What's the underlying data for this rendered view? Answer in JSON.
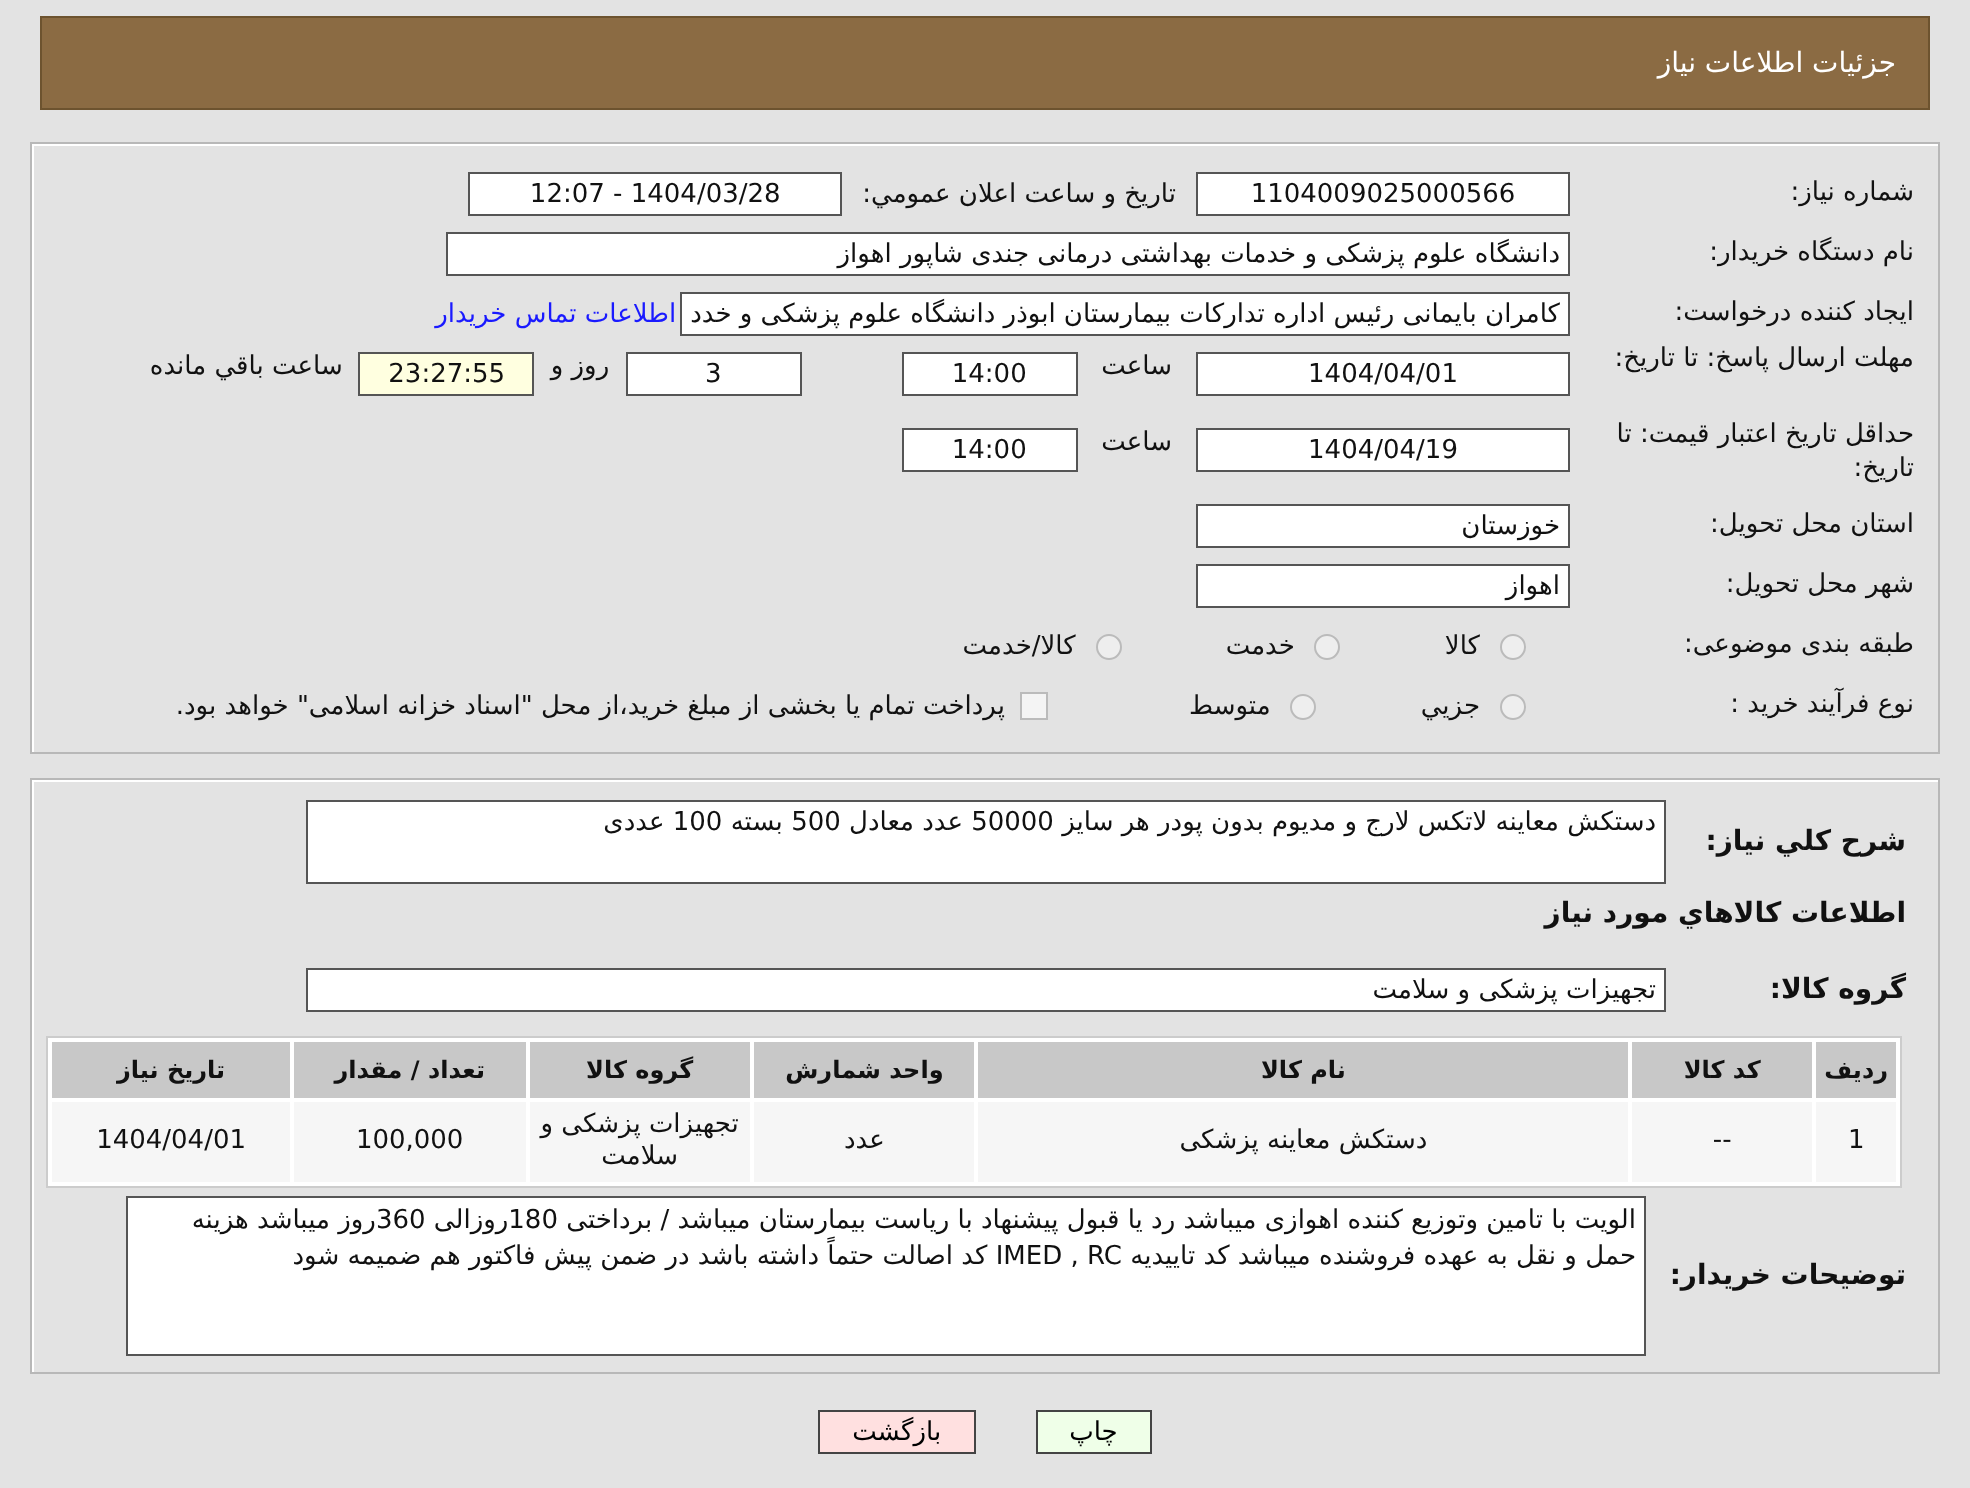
{
  "header": {
    "title": "جزئیات اطلاعات نیاز"
  },
  "details": {
    "need_number": {
      "label": "شماره نیاز:",
      "value": "1104009025000566"
    },
    "announce": {
      "label": "تاریخ و ساعت اعلان عمومي:",
      "value": "1404/03/28 - 12:07"
    },
    "buyer": {
      "label": "نام دستگاه خریدار:",
      "value": "دانشگاه علوم پزشکی و خدمات بهداشتی درمانی جندی شاپور اهواز"
    },
    "creator": {
      "label": "ایجاد کننده درخواست:",
      "value": "کامران بایمانی رئیس اداره تدارکات بیمارستان ابوذر  دانشگاه علوم پزشکی و خدد",
      "link": "اطلاعات تماس خریدار"
    },
    "deadline": {
      "label": "مهلت ارسال پاسخ: تا تاریخ:",
      "date": "1404/04/01",
      "time_label": "ساعت",
      "time": "14:00",
      "days": "3",
      "days_label": "روز و",
      "remaining": "23:27:55",
      "remaining_label": "ساعت باقي مانده"
    },
    "validity": {
      "label": "حداقل تاریخ اعتبار قیمت: تا تاریخ:",
      "date": "1404/04/19",
      "time_label": "ساعت",
      "time": "14:00"
    },
    "province": {
      "label": "استان محل تحویل:",
      "value": "خوزستان"
    },
    "city": {
      "label": "شهر محل تحویل:",
      "value": "اهواز"
    },
    "category": {
      "label": "طبقه بندی موضوعی:",
      "options": [
        {
          "label": "کالا",
          "selected": false
        },
        {
          "label": "خدمت",
          "selected": false
        },
        {
          "label": "کالا/خدمت",
          "selected": false
        }
      ]
    },
    "process": {
      "label": "نوع فرآیند خرید :",
      "options": [
        {
          "label": "جزيي",
          "selected": false
        },
        {
          "label": "متوسط",
          "selected": false
        }
      ],
      "payment_note": {
        "label": "پرداخت تمام یا بخشی از مبلغ خرید،از محل \"اسناد خزانه اسلامی\" خواهد بود.",
        "checked": false
      }
    }
  },
  "goods": {
    "description": {
      "label": "شرح کلي نياز:",
      "value": "دستکش معاینه لاتکس لارج و مدیوم بدون پودر هر سایز 50000 عدد معادل 500 بسته 100 عددی"
    },
    "section_title": "اطلاعات کالاهاي مورد نياز",
    "group": {
      "label": "گروه کالا:",
      "value": "تجهیزات پزشکی و سلامت"
    },
    "table": {
      "columns": [
        "ردیف",
        "کد کالا",
        "نام کالا",
        "واحد شمارش",
        "گروه کالا",
        "تعداد / مقدار",
        "تاریخ نیاز"
      ],
      "rows": [
        [
          "1",
          "--",
          "دستکش معاینه پزشکی",
          "عدد",
          "تجهیزات پزشکی و سلامت",
          "100,000",
          "1404/04/01"
        ]
      ]
    },
    "notes": {
      "label": "توضیحات خریدار:",
      "value": "الویت با تامین وتوزیع کننده اهوازی میباشد رد یا قبول پیشنهاد با ریاست بیمارستان میباشد / برداختی 180روزالی 360روز میباشد  هزینه حمل و نقل به عهده فروشنده میباشد کد تاییدیه IMED , RC کد اصالت حتماً داشته باشد در ضمن پیش فاکتور هم ضمیمه شود"
    }
  },
  "buttons": [
    {
      "kind": "print",
      "label": "چاپ"
    },
    {
      "kind": "back",
      "label": "بازگشت"
    }
  ]
}
